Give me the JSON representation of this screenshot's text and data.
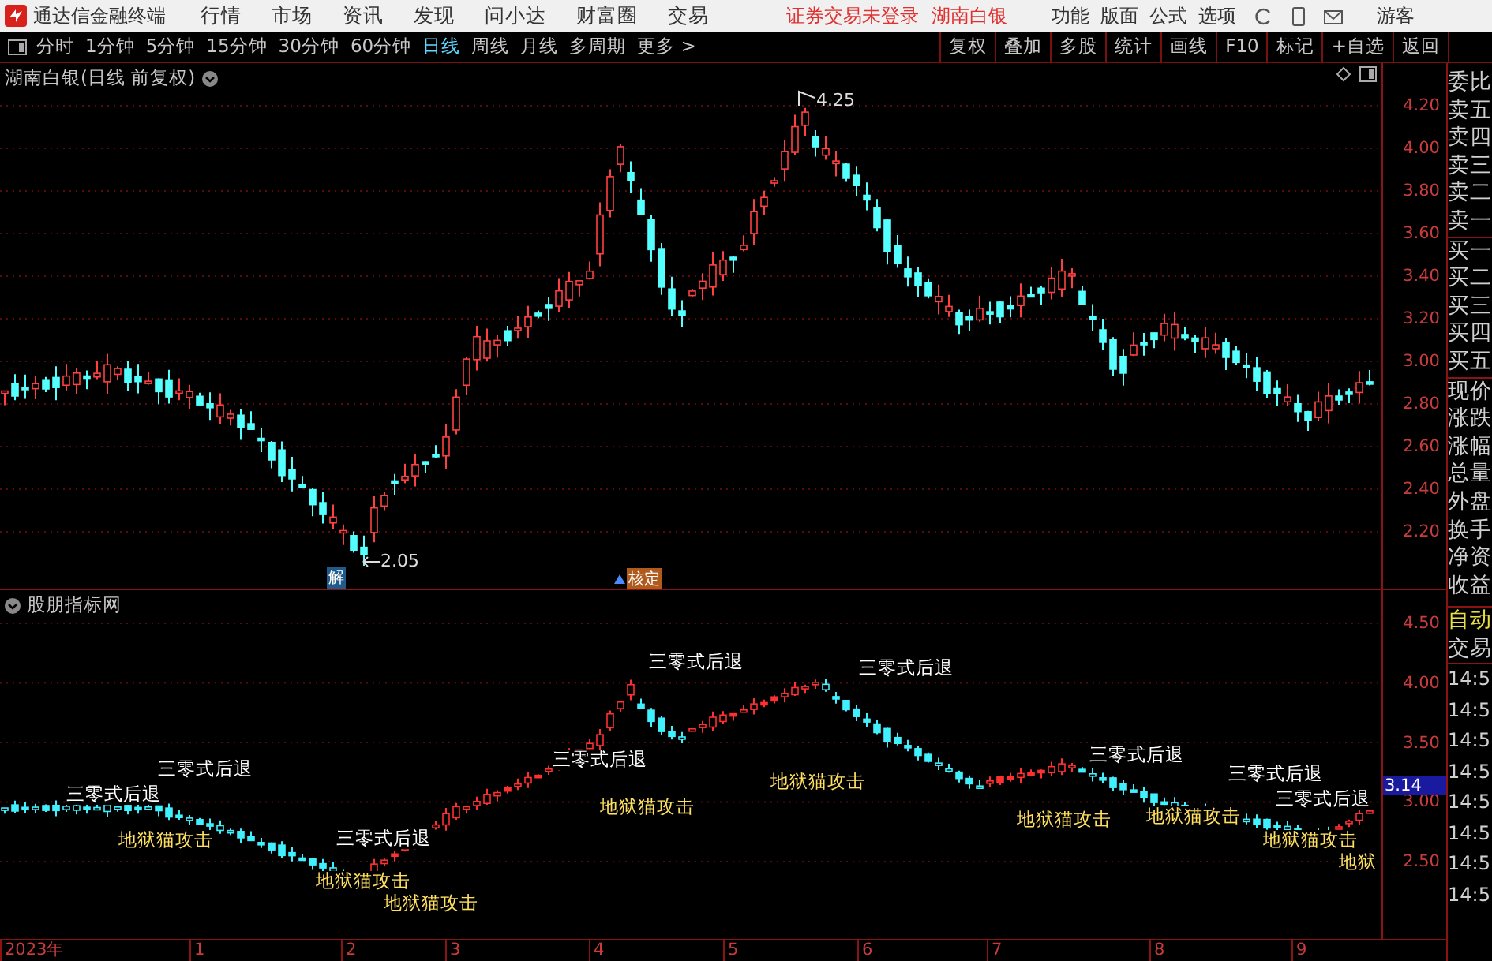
{
  "menu_bar": {
    "app_title": "通达信金融终端",
    "menus": [
      "行情",
      "市场",
      "资讯",
      "发现",
      "问小达",
      "财富圈",
      "交易"
    ],
    "notices": [
      "证券交易未登录",
      "湖南白银"
    ],
    "actions": [
      "功能",
      "版面",
      "公式",
      "选项"
    ],
    "user": "游客"
  },
  "toolbar": {
    "periods": [
      {
        "label": "分时",
        "selected": false
      },
      {
        "label": "1分钟",
        "selected": false
      },
      {
        "label": "5分钟",
        "selected": false
      },
      {
        "label": "15分钟",
        "selected": false
      },
      {
        "label": "30分钟",
        "selected": false
      },
      {
        "label": "60分钟",
        "selected": false
      },
      {
        "label": "日线",
        "selected": true
      },
      {
        "label": "周线",
        "selected": false
      },
      {
        "label": "月线",
        "selected": false
      },
      {
        "label": "多周期",
        "selected": false
      },
      {
        "label": "更多 >",
        "selected": false
      }
    ],
    "buttons": [
      "复权",
      "叠加",
      "多股",
      "统计",
      "画线",
      "F10",
      "标记",
      "+自选",
      "返回"
    ]
  },
  "price_chart": {
    "title": "湖南白银(日线 前复权)",
    "high_label": "4.25",
    "low_label": "2.05",
    "badges": [
      {
        "kind": "unlock",
        "text": "解"
      },
      {
        "kind": "verify",
        "text": "核定"
      }
    ],
    "y_ticks": [
      "4.20",
      "4.00",
      "3.80",
      "3.60",
      "3.40",
      "3.20",
      "3.00",
      "2.80",
      "2.60",
      "2.40",
      "2.20"
    ]
  },
  "indicator_chart": {
    "title": "股朋指标网",
    "signals": [
      {
        "kind": "retreat",
        "text": "三零式后退"
      },
      {
        "kind": "retreat",
        "text": "三零式后退"
      },
      {
        "kind": "retreat",
        "text": "三零式后退"
      },
      {
        "kind": "retreat",
        "text": "三零式后退"
      },
      {
        "kind": "retreat",
        "text": "三零式后退"
      },
      {
        "kind": "retreat",
        "text": "三零式后退"
      },
      {
        "kind": "retreat",
        "text": "三零式后退"
      },
      {
        "kind": "retreat",
        "text": "三零式后退"
      },
      {
        "kind": "retreat",
        "text": "三零式后退"
      },
      {
        "kind": "attack",
        "text": "地狱猫攻击"
      },
      {
        "kind": "attack",
        "text": "地狱猫攻击"
      },
      {
        "kind": "attack",
        "text": "地狱猫攻击"
      },
      {
        "kind": "attack",
        "text": "地狱猫攻击"
      },
      {
        "kind": "attack",
        "text": "地狱猫攻击"
      },
      {
        "kind": "attack",
        "text": "地狱猫攻击"
      },
      {
        "kind": "attack",
        "text": "地狱猫攻击"
      },
      {
        "kind": "attack",
        "text": "地狱猫攻击"
      },
      {
        "kind": "attack",
        "text": "地狱"
      }
    ],
    "y_ticks": [
      "4.50",
      "4.00",
      "3.50",
      "3.00",
      "2.50"
    ],
    "price_tag": "3.14"
  },
  "x_axis": [
    "2023年",
    "1",
    "2",
    "3",
    "4",
    "5",
    "6",
    "7",
    "8",
    "9"
  ],
  "quote_panel": {
    "fields": [
      "委比",
      "卖五",
      "卖四",
      "卖三",
      "卖二",
      "卖一",
      "买一",
      "买二",
      "买三",
      "买四",
      "买五",
      "现价",
      "涨跌",
      "涨幅",
      "总量",
      "外盘",
      "换手",
      "净资",
      "收益"
    ],
    "trade_tabs": [
      "自动",
      "交易"
    ],
    "times": [
      "14:5",
      "14:5",
      "14:5",
      "14:5",
      "14:5",
      "14:5",
      "14:5",
      "14:5"
    ]
  }
}
